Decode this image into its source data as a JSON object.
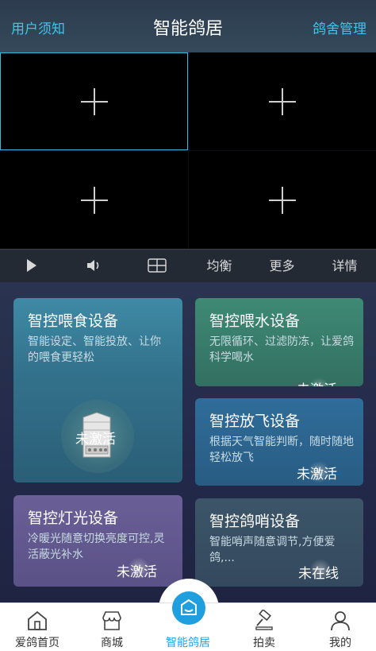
{
  "header": {
    "left_link": "用户须知",
    "title": "智能鸽居",
    "right_link": "鸽舍管理"
  },
  "video_grid": {
    "cells": [
      "add-camera-1",
      "add-camera-2",
      "add-camera-3",
      "add-camera-4"
    ]
  },
  "controls": {
    "play_icon": "play-icon",
    "volume_icon": "volume-icon",
    "layout_icon": "grid-layout-icon",
    "balance": "均衡",
    "more": "更多",
    "details": "详情"
  },
  "cards": {
    "feed": {
      "title": "智控喂食设备",
      "desc": "智能设定、智能投放、让你的喂食更轻松",
      "status": "未激活"
    },
    "water": {
      "title": "智控喂水设备",
      "desc": "无限循环、过滤防冻，让爱鸽科学喝水",
      "status": "未激活"
    },
    "fly": {
      "title": "智控放飞设备",
      "desc": "根据天气智能判断，随时随地轻松放飞",
      "status": "未激活"
    },
    "light": {
      "title": "智控灯光设备",
      "desc": "冷暖光随意切换亮度可控,灵活蔽光补水",
      "status": "未激活"
    },
    "whistle": {
      "title": "智控鸽哨设备",
      "desc": "智能哨声随意调节,方便爱鸽,...",
      "status": "未在线"
    }
  },
  "tabbar": {
    "home": "爱鸽首页",
    "mall": "商城",
    "smart": "智能鸽居",
    "auction": "拍卖",
    "mine": "我的"
  },
  "colors": {
    "accent": "#22a3e6",
    "header_link": "#3fc4ee"
  }
}
